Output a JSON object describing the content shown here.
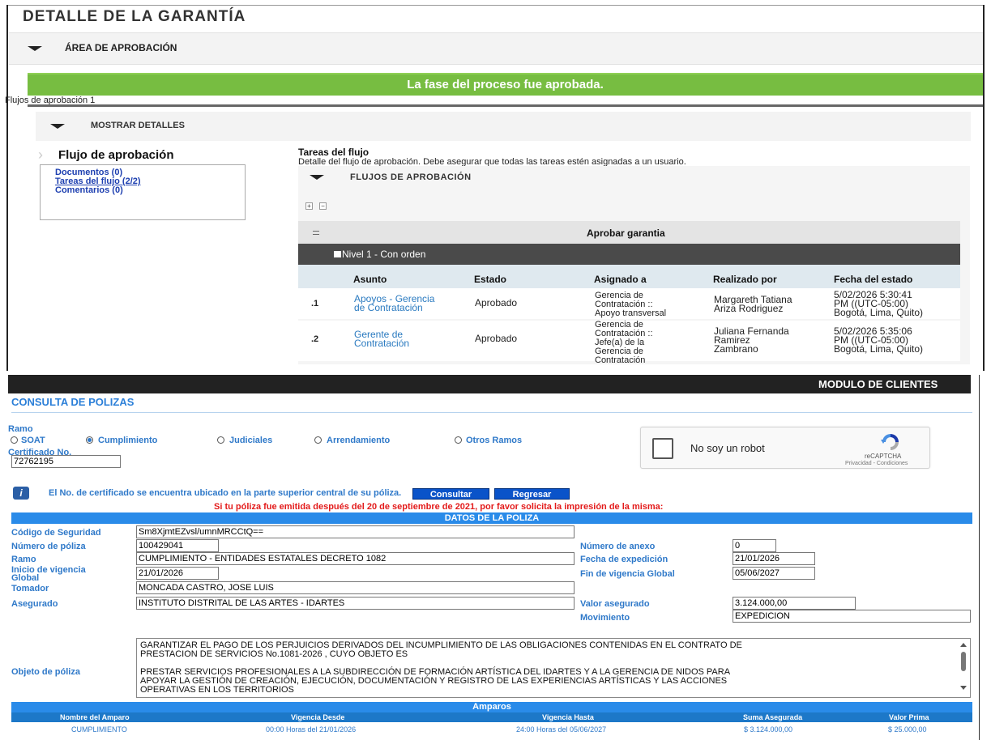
{
  "detail": {
    "title": "DETALLE DE LA GARANTÍA",
    "area_label": "ÁREA DE APROBACIÓN",
    "phase_banner": "La fase del proceso fue aprobada.",
    "flows_label": "Flujos de aprobación 1",
    "show_details": "MOSTRAR DETALLES",
    "flow_sidebar": {
      "title": "Flujo de aprobación",
      "links": [
        "Documentos (0)",
        "Tareas del flujo (2/2)",
        "Comentarios (0)"
      ]
    },
    "tasks": {
      "title": "Tareas del flujo",
      "description": "Detalle del flujo de aprobación. Debe asegurar que todas las tareas estén asignadas a un usuario.",
      "section_label": "FLUJOS DE APROBACIÓN",
      "expand_symbol": "+",
      "collapse_symbol": "−",
      "group_label": "Aprobar garantia",
      "level_label": "Nivel 1 - Con orden",
      "columns": [
        "Asunto",
        "Estado",
        "Asignado a",
        "Realizado por",
        "Fecha del estado"
      ],
      "rows": [
        {
          "num": ".1",
          "subject": [
            "Apoyos - Gerencia",
            "de Contratación"
          ],
          "status": "Aprobado",
          "assigned": [
            "Gerencia de",
            "Contratación ::",
            "Apoyo transversal"
          ],
          "done_by": [
            "Margareth Tatiana",
            "Ariza Rodriguez"
          ],
          "date": [
            "5/02/2026 5:30:41",
            "PM"
          ],
          "tz": [
            "((UTC-05:00)",
            "Bogotá, Lima, Quito)"
          ]
        },
        {
          "num": ".2",
          "subject": [
            "Gerente de",
            "Contratación"
          ],
          "status": "Aprobado",
          "assigned": [
            "Gerencia de",
            "Contratación ::",
            "Jefe(a) de la",
            "Gerencia de",
            "Contratación"
          ],
          "done_by": [
            "Juliana Fernanda",
            "Ramirez",
            "Zambrano"
          ],
          "date": [
            "5/02/2026 5:35:06",
            "PM"
          ],
          "tz": [
            "((UTC-05:00)",
            "Bogotá, Lima, Quito)"
          ]
        }
      ]
    }
  },
  "clients": {
    "module_label": "MODULO DE CLIENTES",
    "title": "CONSULTA DE POLIZAS",
    "ramo_label": "Ramo",
    "ramo_options": [
      {
        "label": "SOAT",
        "selected": false
      },
      {
        "label": "Cumplimiento",
        "selected": true
      },
      {
        "label": "Judiciales",
        "selected": false
      },
      {
        "label": "Arrendamiento",
        "selected": false
      },
      {
        "label": "Otros Ramos",
        "selected": false
      }
    ],
    "cert_label": "Certificado No.",
    "cert_value": "72762195",
    "cert_hint": "El No. de certificado se encuentra ubicado en la parte superior central de su póliza.",
    "info_glyph": "i",
    "captcha": {
      "text": "No soy un robot",
      "brand": "reCAPTCHA",
      "links": "Privacidad - Condiciones"
    },
    "buttons": {
      "consult": "Consultar",
      "back": "Regresar"
    },
    "notice": "Si tu póliza fue emitida después del 20 de septiembre de 2021, por favor solicita la impresión de la misma:",
    "policy_header": "DATOS DE LA POLIZA",
    "fields": {
      "security_code": {
        "label": "Código de Seguridad",
        "value": "Sm8XjmtEZvsl/umnMRCCtQ=="
      },
      "policy_number": {
        "label": "Número de póliza",
        "value": "100429041"
      },
      "annex_number": {
        "label": "Número de anexo",
        "value": "0"
      },
      "ramo": {
        "label": "Ramo",
        "value": "CUMPLIMIENTO - ENTIDADES ESTATALES DECRETO 1082"
      },
      "issue_date": {
        "label": "Fecha de expedición",
        "value": "21/01/2026"
      },
      "start_label_1": "Inicio de vigencia",
      "start_label_2": "Global",
      "start_value": "21/01/2026",
      "end_date": {
        "label": "Fin de vigencia Global",
        "value": "05/06/2027"
      },
      "holder": {
        "label": "Tomador",
        "value": "MONCADA CASTRO, JOSE LUIS"
      },
      "insured": {
        "label": "Asegurado",
        "value": "INSTITUTO DISTRITAL DE LAS ARTES - IDARTES"
      },
      "insured_value": {
        "label": "Valor asegurado",
        "value": "3.124.000,00"
      },
      "movement": {
        "label": "Movimiento",
        "value": "EXPEDICION"
      },
      "object": {
        "label": "Objeto de póliza",
        "lines_a": [
          "GARANTIZAR EL PAGO DE LOS PERJUICIOS DERIVADOS DEL INCUMPLIMIENTO DE LAS OBLIGACIONES CONTENIDAS EN EL CONTRATO DE",
          "PRESTACION DE SERVICIOS No.1081-2026 , CUYO OBJETO ES"
        ],
        "lines_b": [
          "PRESTAR SERVICIOS PROFESIONALES A LA SUBDIRECCIÓN DE FORMACIÓN ARTÍSTICA DEL IDARTES Y A LA GERENCIA DE NIDOS PARA",
          "APOYAR LA GESTIÓN DE CREACIÓN, EJECUCIÓN, DOCUMENTACIÓN Y REGISTRO DE LAS EXPERIENCIAS ARTÍSTICAS Y LAS ACCIONES",
          "OPERATIVAS EN LOS TERRITORIOS"
        ]
      }
    },
    "amparos": {
      "title": "Amparos",
      "columns": [
        "Nombre del Amparo",
        "Vigencia Desde",
        "Vigencia Hasta",
        "Suma Asegurada",
        "Valor Prima"
      ],
      "row": [
        "CUMPLIMIENTO",
        "00:00 Horas del 21/01/2026",
        "24:00 Horas del 05/06/2027",
        "$ 3.124.000,00",
        "$ 25.000,00"
      ]
    }
  }
}
